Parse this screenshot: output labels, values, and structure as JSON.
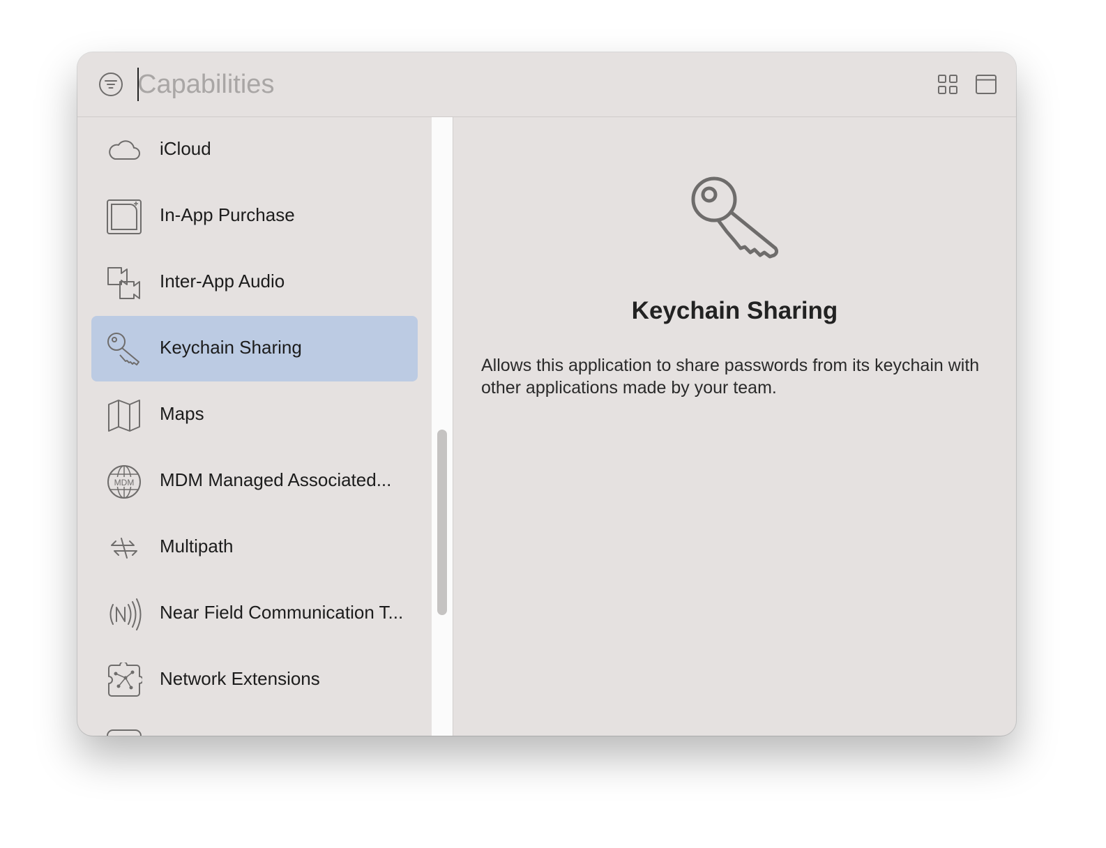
{
  "search": {
    "placeholder": "Capabilities",
    "value": ""
  },
  "toolbar": {
    "filter_icon": "filter-circle-icon",
    "grid_icon": "grid-view-icon",
    "window_icon": "window-icon"
  },
  "sidebar": {
    "items": [
      {
        "label": "iCloud",
        "icon": "cloud-icon"
      },
      {
        "label": "In-App Purchase",
        "icon": "in-app-purchase-icon"
      },
      {
        "label": "Inter-App Audio",
        "icon": "inter-app-audio-icon"
      },
      {
        "label": "Keychain Sharing",
        "icon": "key-icon",
        "selected": true
      },
      {
        "label": "Maps",
        "icon": "map-icon"
      },
      {
        "label": "MDM Managed Associated...",
        "icon": "mdm-globe-icon"
      },
      {
        "label": "Multipath",
        "icon": "multipath-arrows-icon"
      },
      {
        "label": "Near Field Communication T...",
        "icon": "nfc-icon"
      },
      {
        "label": "Network Extensions",
        "icon": "network-extensions-icon"
      },
      {
        "label": "",
        "icon": "rounded-rect-icon"
      }
    ]
  },
  "detail": {
    "icon": "key-icon",
    "title": "Keychain Sharing",
    "description": "Allows this application to share passwords from its keychain with other applications made by your team."
  },
  "colors": {
    "window_bg": "#e5e1e0",
    "selection": "#bccbe3",
    "icon_stroke": "#6e6c6b"
  }
}
